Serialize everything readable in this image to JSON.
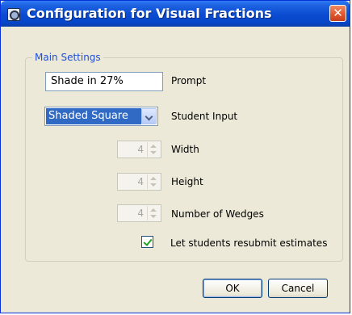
{
  "window": {
    "title": "Configuration for Visual Fractions",
    "close_label": "✕"
  },
  "main_settings": {
    "group_label": "Main Settings",
    "prompt": {
      "value": "Shade in 27%",
      "label": "Prompt"
    },
    "student_input": {
      "selected": "Shaded Square",
      "label": "Student Input"
    },
    "width": {
      "value": "4",
      "label": "Width"
    },
    "height": {
      "value": "4",
      "label": "Height"
    },
    "wedges": {
      "value": "4",
      "label": "Number of Wedges"
    },
    "resubmit": {
      "checked": true,
      "label": "Let students resubmit estimates"
    }
  },
  "buttons": {
    "ok": "OK",
    "cancel": "Cancel"
  }
}
